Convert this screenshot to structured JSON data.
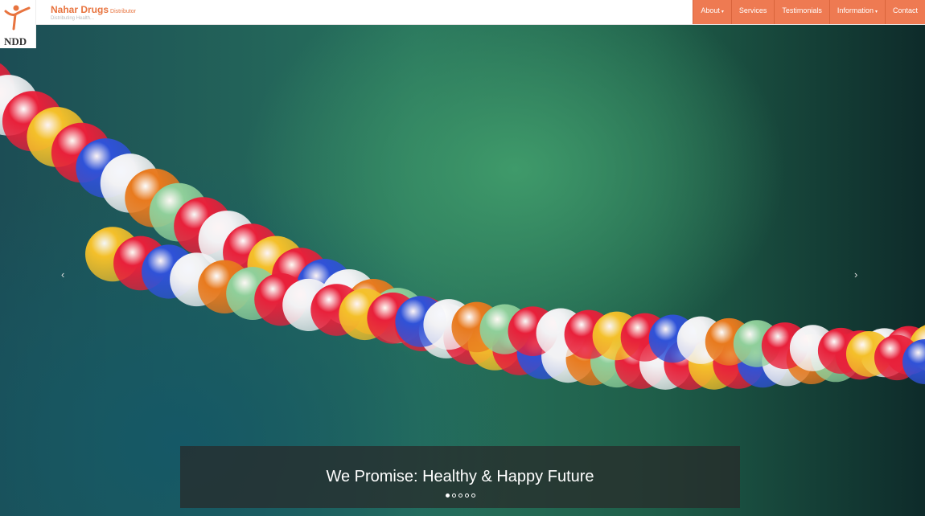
{
  "brand": {
    "name": "Nahar Drugs",
    "suffix": "Distributor",
    "tagline": "Distributing Health..."
  },
  "logo": {
    "letters": "NDD"
  },
  "nav": {
    "items": [
      {
        "label": "About",
        "dropdown": true
      },
      {
        "label": "Services",
        "dropdown": false
      },
      {
        "label": "Testimonials",
        "dropdown": false
      },
      {
        "label": "Information",
        "dropdown": true
      },
      {
        "label": "Contact",
        "dropdown": false
      }
    ],
    "caret": "▾"
  },
  "colors": {
    "accent": "#ee7a52",
    "brand": "#e8743f"
  },
  "carousel": {
    "caption": "We Promise: Healthy & Happy Future",
    "prev_icon": "‹",
    "next_icon": "›",
    "slide_count": 5,
    "active_slide": 1
  }
}
